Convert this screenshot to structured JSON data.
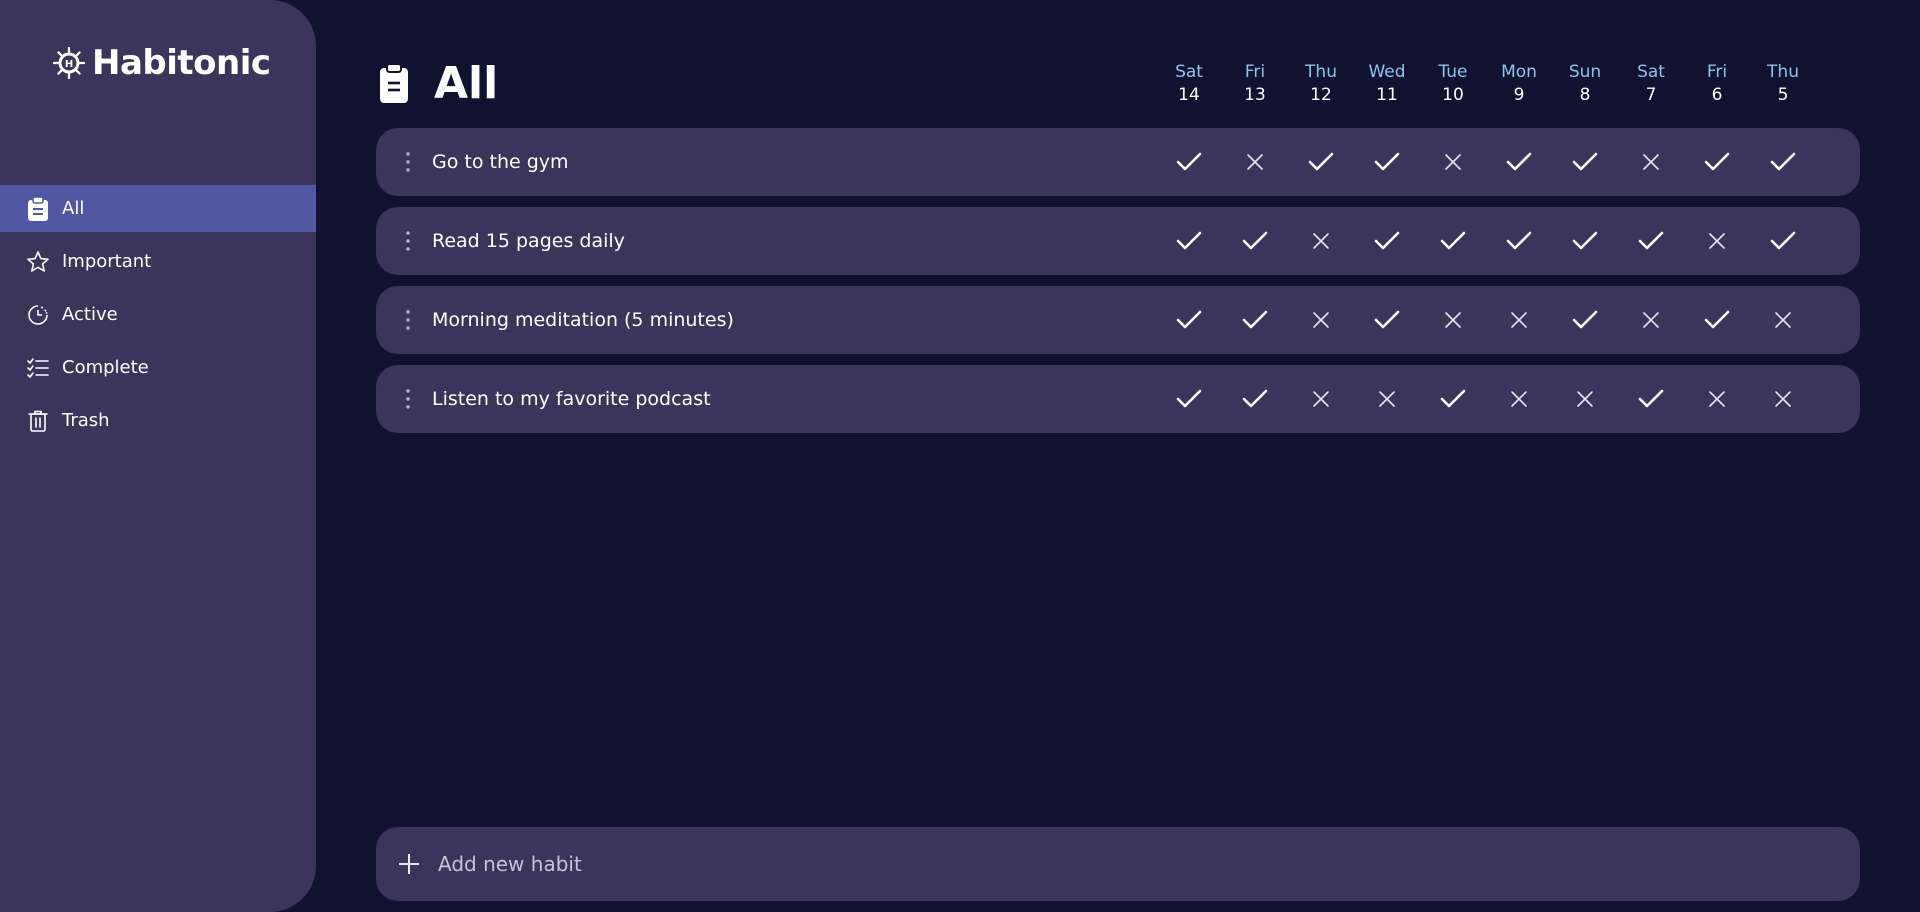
{
  "app": {
    "name": "Habitonic"
  },
  "colors": {
    "background": "#111130",
    "panel": "#3b355c",
    "active": "#5157a3",
    "day_name": "#8ec5e8"
  },
  "sidebar": {
    "items": [
      {
        "label": "All",
        "icon": "clipboard-icon",
        "active": true
      },
      {
        "label": "Important",
        "icon": "star-icon",
        "active": false
      },
      {
        "label": "Active",
        "icon": "clock-pie-icon",
        "active": false
      },
      {
        "label": "Complete",
        "icon": "checklist-icon",
        "active": false
      },
      {
        "label": "Trash",
        "icon": "trash-icon",
        "active": false
      }
    ]
  },
  "header": {
    "title": "All",
    "icon": "clipboard-icon"
  },
  "days": [
    {
      "name": "Sat",
      "num": "14"
    },
    {
      "name": "Fri",
      "num": "13"
    },
    {
      "name": "Thu",
      "num": "12"
    },
    {
      "name": "Wed",
      "num": "11"
    },
    {
      "name": "Tue",
      "num": "10"
    },
    {
      "name": "Mon",
      "num": "9"
    },
    {
      "name": "Sun",
      "num": "8"
    },
    {
      "name": "Sat",
      "num": "7"
    },
    {
      "name": "Fri",
      "num": "6"
    },
    {
      "name": "Thu",
      "num": "5"
    }
  ],
  "habits": [
    {
      "label": "Go to the gym",
      "marks": [
        true,
        false,
        true,
        true,
        false,
        true,
        true,
        false,
        true,
        true
      ]
    },
    {
      "label": "Read 15 pages daily",
      "marks": [
        true,
        true,
        false,
        true,
        true,
        true,
        true,
        true,
        false,
        true
      ]
    },
    {
      "label": "Morning meditation (5 minutes)",
      "marks": [
        true,
        true,
        false,
        true,
        false,
        false,
        true,
        false,
        true,
        false
      ]
    },
    {
      "label": "Listen to my favorite podcast",
      "marks": [
        true,
        true,
        false,
        false,
        true,
        false,
        false,
        true,
        false,
        false
      ]
    }
  ],
  "add_habit": {
    "placeholder": "Add new habit",
    "icon": "plus-icon"
  }
}
